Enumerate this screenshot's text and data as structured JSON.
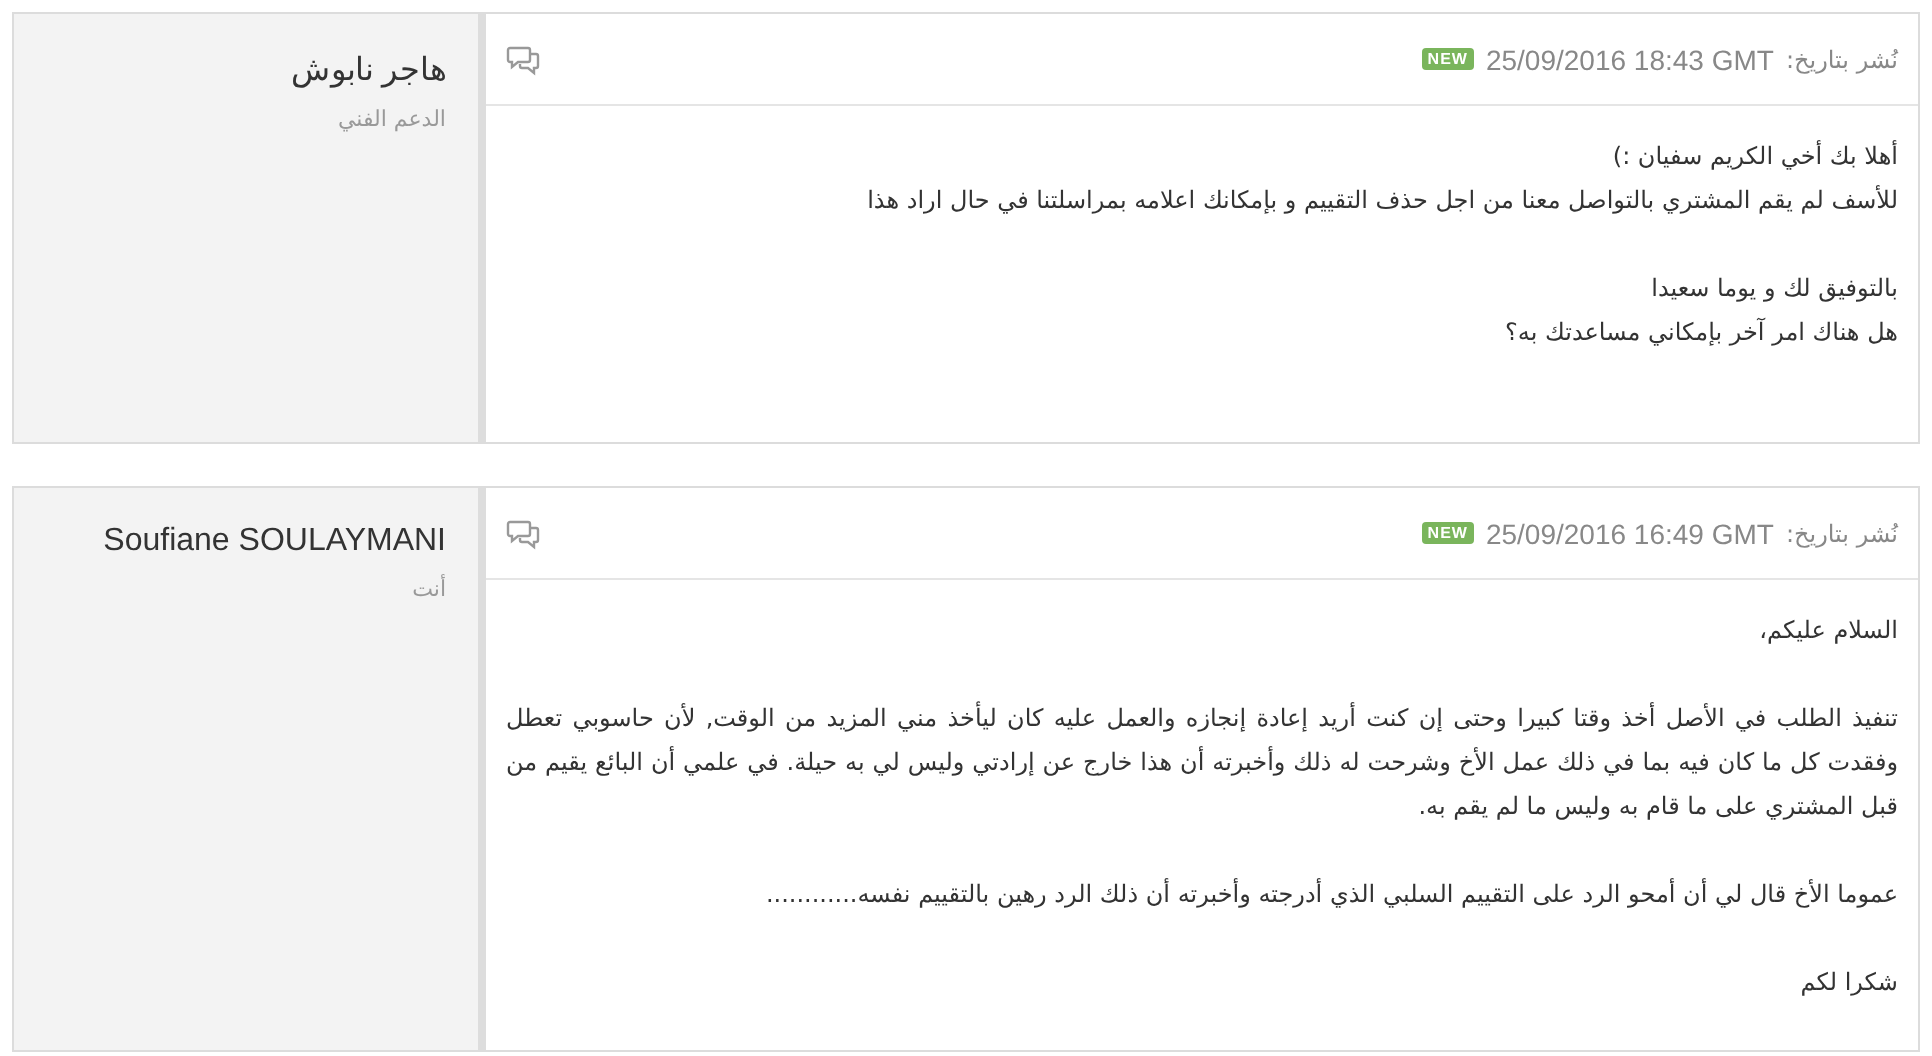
{
  "messages": [
    {
      "author": {
        "name": "هاجر نابوش",
        "role": "الدعم الفني"
      },
      "posted_label": "نُشر بتاريخ:",
      "posted_at": "25/09/2016 18:43 GMT",
      "badge": "NEW",
      "paragraphs": [
        [
          "أهلا بك أخي الكريم سفيان :)",
          "للأسف لم يقم المشتري بالتواصل معنا من اجل حذف التقييم و بإمكانك اعلامه بمراسلتنا في حال اراد هذا"
        ],
        [
          "بالتوفيق لك و يوما سعيدا",
          "هل هناك امر آخر بإمكاني مساعدتك به؟"
        ]
      ]
    },
    {
      "author": {
        "name": "Soufiane SOULAYMANI",
        "role": "أنت"
      },
      "posted_label": "نُشر بتاريخ:",
      "posted_at": "25/09/2016 16:49 GMT",
      "badge": "NEW",
      "paragraphs": [
        [
          "السلام عليكم،"
        ],
        [
          "تنفيذ الطلب في الأصل أخذ وقتا كبيرا وحتى إن كنت أريد إعادة إنجازه والعمل عليه كان ليأخذ مني المزيد من الوقت, لأن حاسوبي تعطل وفقدت كل ما كان فيه بما في ذلك عمل الأخ وشرحت له ذلك وأخبرته أن هذا خارج عن إرادتي وليس لي به حيلة. في علمي أن البائع يقيم من قبل المشتري على ما قام به وليس ما لم يقم به."
        ],
        [
          "عموما الأخ قال لي أن أمحو الرد على التقييم السلبي الذي أدرجته وأخبرته أن ذلك الرد رهين بالتقييم نفسه............"
        ],
        [
          "شكرا لكم"
        ]
      ]
    }
  ]
}
